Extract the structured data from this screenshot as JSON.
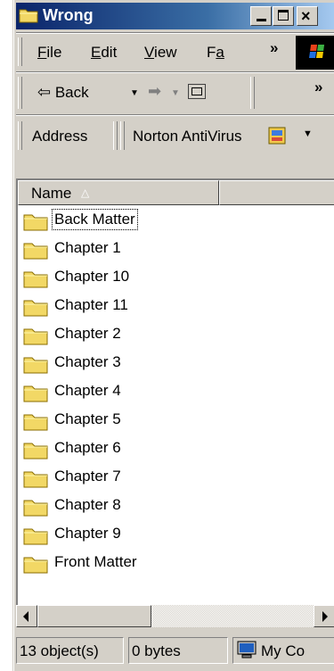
{
  "window": {
    "title": "Wrong"
  },
  "menu": {
    "items": [
      {
        "label": "File",
        "key": "F"
      },
      {
        "label": "Edit",
        "key": "E"
      },
      {
        "label": "View",
        "key": "V"
      },
      {
        "label": "Fa",
        "key": "a"
      }
    ],
    "overflow": "»"
  },
  "toolbar": {
    "back_label": "Back",
    "overflow": "»"
  },
  "address_bar": {
    "label": "Address",
    "norton_label": "Norton AntiVirus"
  },
  "list": {
    "columns": [
      {
        "label": "Name",
        "sort": "ascending"
      }
    ],
    "items": [
      {
        "name": "Back Matter",
        "focused": true
      },
      {
        "name": "Chapter 1"
      },
      {
        "name": "Chapter 10"
      },
      {
        "name": "Chapter 11"
      },
      {
        "name": "Chapter 2"
      },
      {
        "name": "Chapter 3"
      },
      {
        "name": "Chapter 4"
      },
      {
        "name": "Chapter 5"
      },
      {
        "name": "Chapter 6"
      },
      {
        "name": "Chapter 7"
      },
      {
        "name": "Chapter 8"
      },
      {
        "name": "Chapter 9"
      },
      {
        "name": "Front Matter"
      }
    ]
  },
  "status_bar": {
    "objects": "13 object(s)",
    "size": "0 bytes",
    "zone": "My Co"
  },
  "colors": {
    "title_start": "#0a246a",
    "title_end": "#a6caf0",
    "face": "#d4d0c8",
    "folder": "#f2d865"
  },
  "icons": {
    "title": "folder-icon",
    "folder": "folder-icon",
    "up": "up-folder-icon",
    "norton": "norton-antivirus-icon",
    "zone": "my-computer-icon"
  }
}
